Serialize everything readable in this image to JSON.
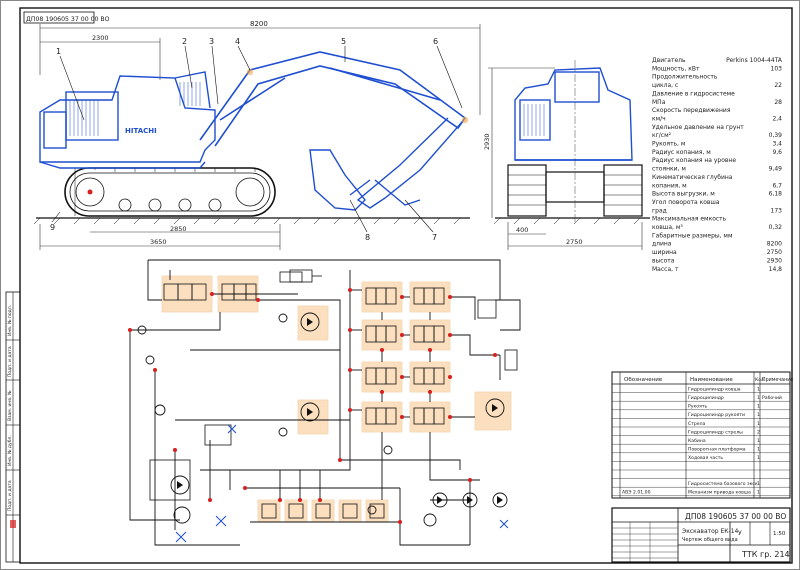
{
  "sheet": {
    "stamp_code": "ДП08 190605 37 00 00 ВО"
  },
  "front_view": {
    "dims": {
      "overall_length": "8200",
      "front_offset": "2300",
      "track_length": "2850",
      "base_length": "3650"
    },
    "callouts": [
      "1",
      "2",
      "3",
      "4",
      "5",
      "6",
      "7",
      "8",
      "9"
    ],
    "brand_text": "HITACHI"
  },
  "side_view": {
    "dims": {
      "height": "2930",
      "track_width": "400",
      "width": "2750"
    }
  },
  "specs": [
    {
      "label": "Двигатель",
      "value": "Perkins 1004-44TA"
    },
    {
      "label": "Мощность, кВт",
      "value": "103"
    },
    {
      "label": "Продолжительность",
      "value": ""
    },
    {
      "label": "цикла, с",
      "value": "22"
    },
    {
      "label": "Давление в гидросистеме",
      "value": ""
    },
    {
      "label": "МПа",
      "value": "28"
    },
    {
      "label": "Скорость передвижения",
      "value": ""
    },
    {
      "label": "км/ч",
      "value": "2,4"
    },
    {
      "label": "Удельное давление на грунт",
      "value": ""
    },
    {
      "label": "кг/см²",
      "value": "0,39"
    },
    {
      "label": "Рукоять, м",
      "value": "3,4"
    },
    {
      "label": "Радиус копания, м",
      "value": "9,6"
    },
    {
      "label": "Радиус копания на уровне",
      "value": ""
    },
    {
      "label": "стоянки, м",
      "value": "9,49"
    },
    {
      "label": "Кинематическая глубина",
      "value": ""
    },
    {
      "label": "копания, м",
      "value": "6,7"
    },
    {
      "label": "Высота выгрузки, м",
      "value": "6,18"
    },
    {
      "label": "Угол поворота ковша",
      "value": ""
    },
    {
      "label": "град",
      "value": "173"
    },
    {
      "label": "Максимальная емкость",
      "value": ""
    },
    {
      "label": "ковша, м³",
      "value": "0,32"
    },
    {
      "label": "Габаритные размеры, мм",
      "value": ""
    },
    {
      "label": "длина",
      "value": "8200"
    },
    {
      "label": "ширина",
      "value": "2750"
    },
    {
      "label": "высота",
      "value": "2930"
    },
    {
      "label": "Масса, т",
      "value": "14,8"
    }
  ],
  "parts_table": {
    "headers": [
      "Обозначение",
      "Наименование",
      "Кол.",
      "Примечание"
    ],
    "rows": [
      {
        "code": "",
        "name": "Гидроцилиндр ковша",
        "qty": "1",
        "note": ""
      },
      {
        "code": "",
        "name": "Гидроцилиндр",
        "qty": "1",
        "note": "Рабочий"
      },
      {
        "code": "",
        "name": "Рукоять",
        "qty": "1",
        "note": ""
      },
      {
        "code": "",
        "name": "Гидроцилиндр рукояти",
        "qty": "1",
        "note": ""
      },
      {
        "code": "",
        "name": "Стрела",
        "qty": "1",
        "note": ""
      },
      {
        "code": "",
        "name": "Гидроцилиндр стрелы",
        "qty": "2",
        "note": ""
      },
      {
        "code": "",
        "name": "Кабина",
        "qty": "1",
        "note": ""
      },
      {
        "code": "",
        "name": "Поворотная платформа",
        "qty": "1",
        "note": ""
      },
      {
        "code": "",
        "name": "Ходовая часть",
        "qty": "1",
        "note": ""
      },
      {
        "code": "",
        "name": "",
        "qty": "",
        "note": ""
      },
      {
        "code": "",
        "name": "",
        "qty": "",
        "note": ""
      },
      {
        "code": "",
        "name": "Гидросистема базового экск.",
        "qty": "1",
        "note": ""
      },
      {
        "code": "АВЭ 2.01.00",
        "name": "Механизм привода ковша",
        "qty": "1",
        "note": ""
      }
    ]
  },
  "title_block": {
    "code": "ДП08 190605 37 00 00 ВО",
    "name": "Экскаватор ЕК-14",
    "subtitle": "Чертеж общего вида",
    "org": "ТТК гр. 214",
    "sheet_letter": "У",
    "scale": "1:50"
  },
  "side_stamp_labels": [
    "Инв. № подл.",
    "Подп. и дата",
    "Взам. инв. №",
    "Инв. № дубл.",
    "Подп. и дата"
  ],
  "colors": {
    "drawing_blue": "#1f4fd0",
    "highlight_orange": "#f4a64a",
    "marker_red": "#d81f1f",
    "ink": "#111111"
  }
}
